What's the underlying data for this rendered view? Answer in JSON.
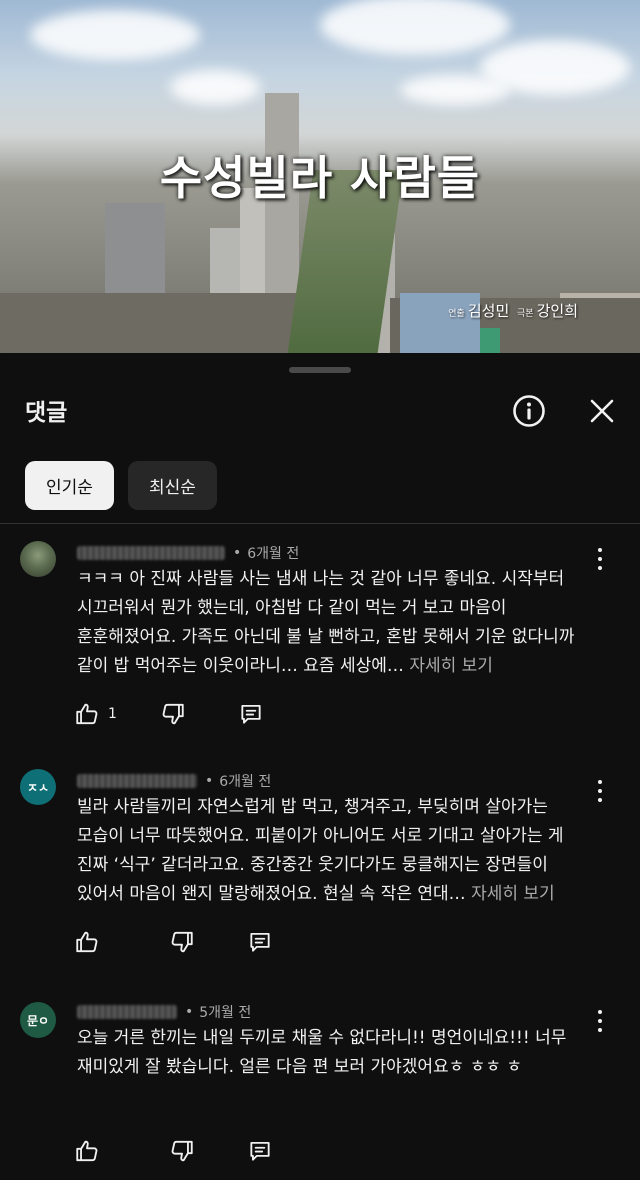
{
  "video": {
    "title": "수성빌라 사람들",
    "credit_tag_1": "연출",
    "credit_name_1": "김성민",
    "credit_tag_2": "극본",
    "credit_name_2": "강인희"
  },
  "sheet": {
    "title": "댓글",
    "info_icon": "info-icon",
    "close_icon": "close-icon",
    "sort_chips": [
      {
        "label": "인기순",
        "active": true
      },
      {
        "label": "최신순",
        "active": false
      }
    ]
  },
  "comments": [
    {
      "time": "6개월 전",
      "body": "ㅋㅋㅋ 아 진짜 사람들 사는 냄새 나는 것 같아 너무 좋네요. 시작부터 시끄러워서 뭔가 했는데, 아침밥 다 같이 먹는 거 보고 마음이 훈훈해졌어요. 가족도 아닌데 불 날 뻔하고, 혼밥 못해서 기운 없다니까 같이 밥 먹어주는 이웃이라니… 요즘 세상에…",
      "more": "자세히 보기",
      "likes": "1"
    },
    {
      "time": "6개월 전",
      "body": "빌라 사람들끼리 자연스럽게 밥 먹고, 챙겨주고, 부딪히며 살아가는 모습이 너무 따뜻했어요. 피붙이가 아니어도 서로 기대고 살아가는 게 진짜 ‘식구’ 같더라고요. 중간중간 웃기다가도 뭉클해지는 장면들이 있어서 마음이 왠지 말랑해졌어요. 현실 속 작은 연대…",
      "more": "자세히 보기",
      "likes": ""
    },
    {
      "time": "5개월 전",
      "body": "오늘 거른 한끼는 내일 두끼로 채울 수 없다라니!! 명언이네요!!! 너무 재미있게 잘 봤습니다. 얼른 다음 편 보러 가야겠어요ㅎ ㅎㅎ ㅎ",
      "more": "",
      "likes": ""
    }
  ]
}
